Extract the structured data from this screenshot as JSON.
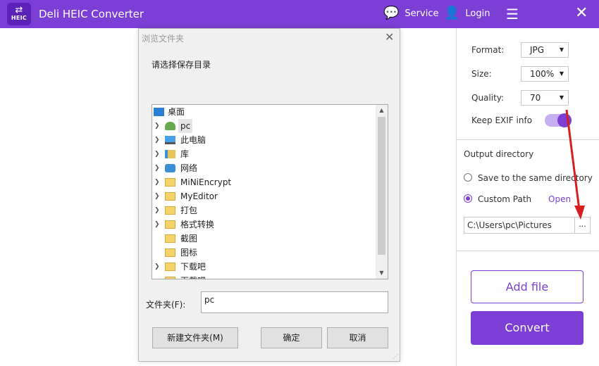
{
  "app": {
    "title": "Deli HEIC Converter",
    "logo_text": "HEIC",
    "logo_arrows": "⇄"
  },
  "header": {
    "service_label": "Service",
    "login_label": "Login"
  },
  "settings": {
    "format_label": "Format:",
    "format_value": "JPG",
    "size_label": "Size:",
    "size_value": "100%",
    "quality_label": "Quality:",
    "quality_value": "70",
    "exif_label": "Keep EXIF info",
    "exif_enabled": true
  },
  "output": {
    "title": "Output directory",
    "same_dir_label": "Save to the same directory",
    "custom_path_label": "Custom Path",
    "open_label": "Open",
    "path_value": "C:\\Users\\pc\\Pictures",
    "browse_label": "..."
  },
  "actions": {
    "add_file_label": "Add file",
    "convert_label": "Convert"
  },
  "dialog": {
    "title": "浏览文件夹",
    "prompt": "请选择保存目录",
    "tree": [
      {
        "label": "桌面",
        "icon": "desktop-icon",
        "expandable": false,
        "indent": 0
      },
      {
        "label": "pc",
        "icon": "user-icon",
        "expandable": true,
        "selected": true
      },
      {
        "label": "此电脑",
        "icon": "computer-icon",
        "expandable": true
      },
      {
        "label": "库",
        "icon": "library-icon",
        "expandable": true
      },
      {
        "label": "网络",
        "icon": "network-icon",
        "expandable": true
      },
      {
        "label": "MiNiEncrypt",
        "icon": "folder-icon",
        "expandable": true
      },
      {
        "label": "MyEditor",
        "icon": "folder-icon",
        "expandable": true
      },
      {
        "label": "打包",
        "icon": "folder-icon",
        "expandable": true
      },
      {
        "label": "格式转换",
        "icon": "folder-icon",
        "expandable": true
      },
      {
        "label": "截图",
        "icon": "folder-icon",
        "expandable": false
      },
      {
        "label": "图标",
        "icon": "folder-icon",
        "expandable": false
      },
      {
        "label": "下载吧",
        "icon": "folder-icon",
        "expandable": true
      },
      {
        "label": "下载吧",
        "icon": "folder-icon",
        "expandable": false
      }
    ],
    "folder_label": "文件夹(F):",
    "folder_value": "pc",
    "new_folder_label": "新建文件夹(M)",
    "ok_label": "确定",
    "cancel_label": "取消"
  },
  "colors": {
    "accent": "#7b3fd6",
    "annotation": "#d71f1f"
  }
}
